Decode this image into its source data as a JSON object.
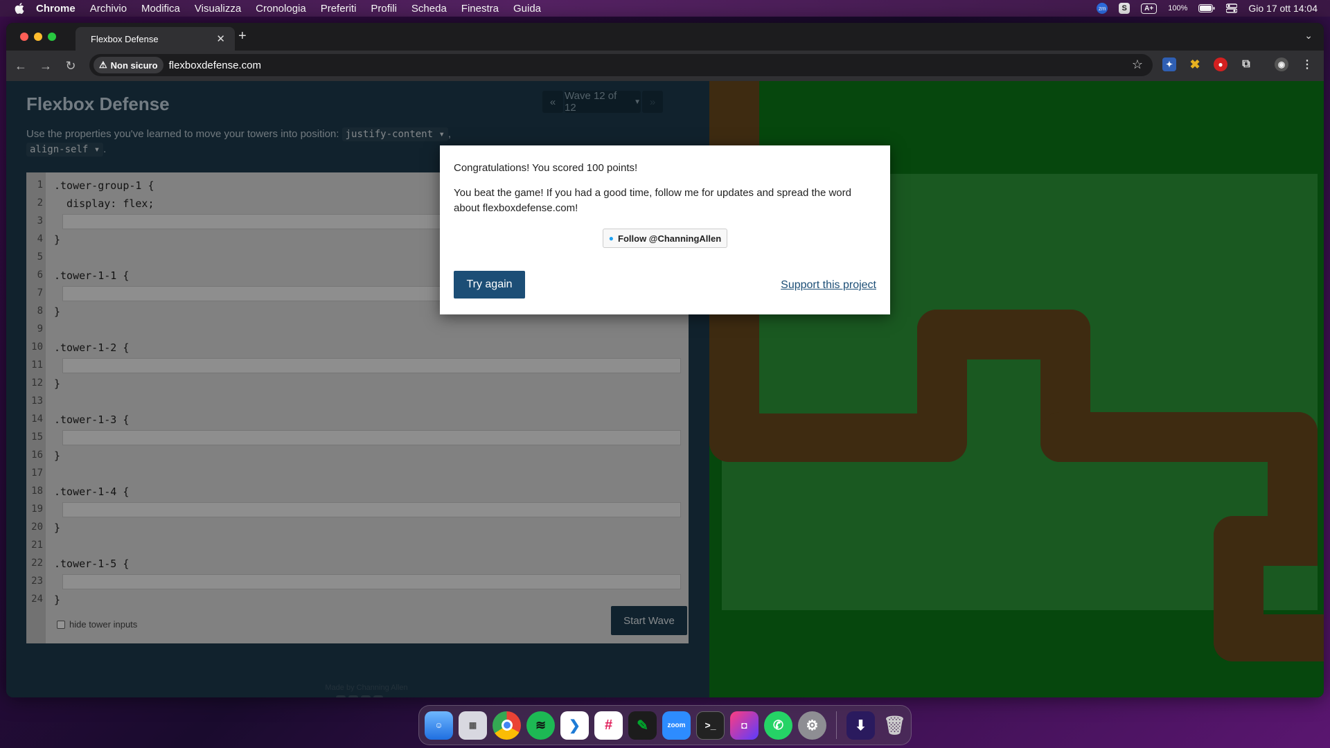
{
  "menubar": {
    "app_name": "Chrome",
    "items": [
      "Archivio",
      "Modifica",
      "Visualizza",
      "Cronologia",
      "Preferiti",
      "Profili",
      "Scheda",
      "Finestra",
      "Guida"
    ],
    "zoom_badge": "zm",
    "accessibility_badge": "A+",
    "battery": "100%",
    "datetime": "Gio 17 ott  14:04"
  },
  "browser": {
    "tab_title": "Flexbox Defense",
    "security_label": "Non sicuro",
    "url": "flexboxdefense.com"
  },
  "game": {
    "title": "Flexbox Defense",
    "wave_label": "Wave 12 of 12",
    "prev_icon": "«",
    "next_icon": "»",
    "instructions_prefix": "Use the properties you've learned to move your towers into position:",
    "prop_1": "justify-content",
    "prop_2": "align-self",
    "code_lines": [
      {
        "n": "1",
        "text": ".tower-group-1 {",
        "input": false
      },
      {
        "n": "2",
        "text": "  display: flex;",
        "input": false
      },
      {
        "n": "3",
        "text": "",
        "input": true
      },
      {
        "n": "4",
        "text": "}",
        "input": false
      },
      {
        "n": "5",
        "text": "",
        "input": false
      },
      {
        "n": "6",
        "text": ".tower-1-1 {",
        "input": false
      },
      {
        "n": "7",
        "text": "",
        "input": true
      },
      {
        "n": "8",
        "text": "}",
        "input": false
      },
      {
        "n": "9",
        "text": "",
        "input": false
      },
      {
        "n": "10",
        "text": ".tower-1-2 {",
        "input": false
      },
      {
        "n": "11",
        "text": "",
        "input": true
      },
      {
        "n": "12",
        "text": "}",
        "input": false
      },
      {
        "n": "13",
        "text": "",
        "input": false
      },
      {
        "n": "14",
        "text": ".tower-1-3 {",
        "input": false
      },
      {
        "n": "15",
        "text": "",
        "input": true
      },
      {
        "n": "16",
        "text": "}",
        "input": false
      },
      {
        "n": "17",
        "text": "",
        "input": false
      },
      {
        "n": "18",
        "text": ".tower-1-4 {",
        "input": false
      },
      {
        "n": "19",
        "text": "",
        "input": true
      },
      {
        "n": "20",
        "text": "}",
        "input": false
      },
      {
        "n": "21",
        "text": "",
        "input": false
      },
      {
        "n": "22",
        "text": ".tower-1-5 {",
        "input": false
      },
      {
        "n": "23",
        "text": "",
        "input": true
      },
      {
        "n": "24",
        "text": "}",
        "input": false
      }
    ],
    "start_wave": "Start Wave",
    "hide_inputs": "hide tower inputs",
    "made_by": "Made by Channing Allen"
  },
  "modal": {
    "score_text": "Congratulations! You scored 100 points!",
    "message": "You beat the game! If you had a good time, follow me for updates and spread the word about flexboxdefense.com!",
    "follow_label": "Follow @ChanningAllen",
    "try_again": "Try again",
    "support": "Support this project"
  },
  "dock": {
    "apps": [
      "finder",
      "launchpad",
      "chrome",
      "spotify",
      "vscode",
      "slack",
      "evernote",
      "zoom",
      "terminal",
      "app",
      "whatsapp",
      "settings",
      "downloads",
      "trash"
    ],
    "zoom_label": "zoom"
  },
  "colors": {
    "left_bg": "#1e3b4f",
    "right_bg": "#0c7a18",
    "board": "#2e9a39",
    "road": "#6b4a1e",
    "accent": "#1c4e76"
  }
}
